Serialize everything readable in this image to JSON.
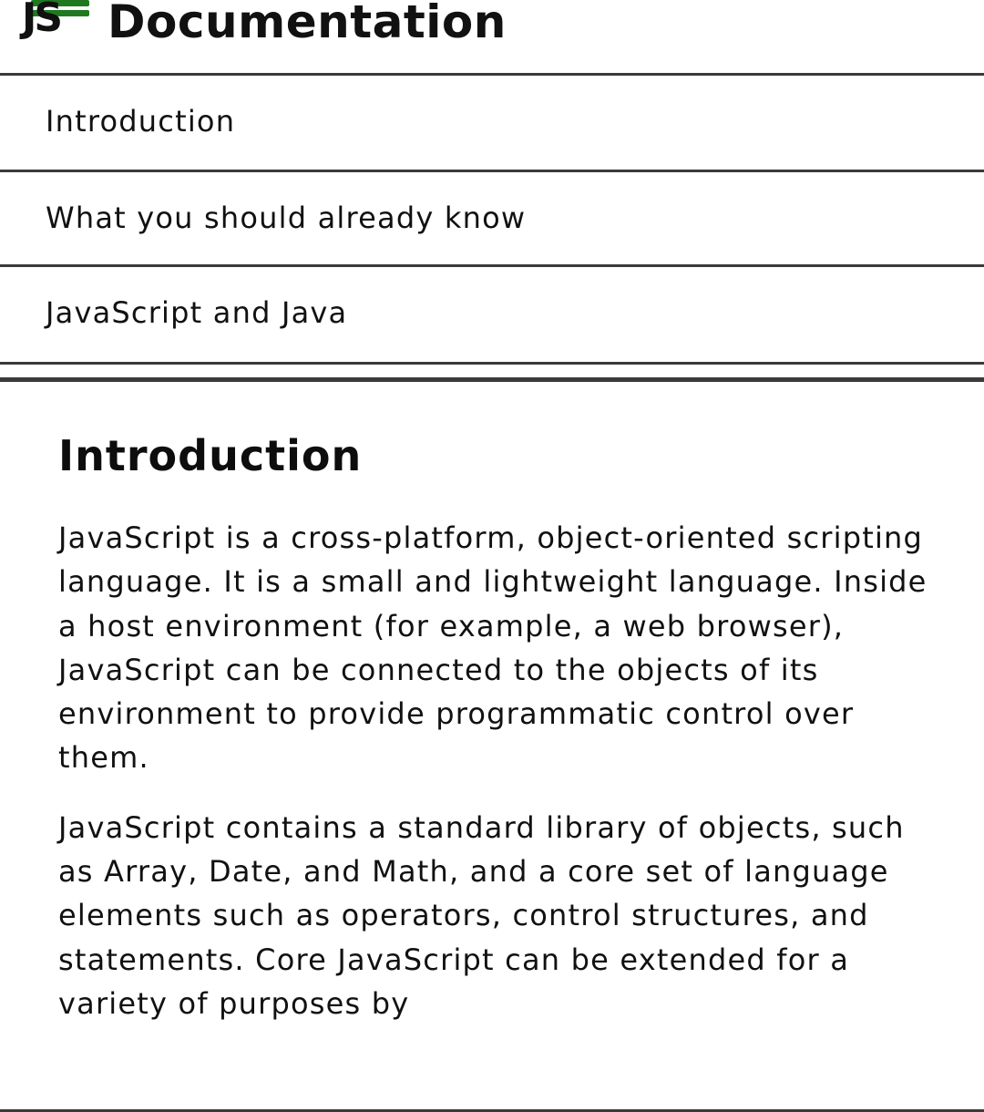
{
  "header": {
    "logo_text": "JS",
    "title": "Documentation"
  },
  "nav": {
    "items": [
      {
        "label": "Introduction"
      },
      {
        "label": "What you should already know"
      },
      {
        "label": "JavaScript and Java"
      }
    ]
  },
  "main": {
    "section_title": "Introduction",
    "paragraphs": [
      "JavaScript is a cross-platform, object-oriented scripting language. It is a small and lightweight language. Inside a host environment (for example, a web browser), JavaScript can be connected to the objects of its environment to provide programmatic control over them.",
      "JavaScript contains a standard library of objects, such as Array, Date, and Math, and a core set of language elements such as operators, control structures, and statements. Core JavaScript can be extended for a variety of purposes by"
    ]
  },
  "colors": {
    "logo_accent": "#1f7a1f",
    "rule": "#3a3a3a",
    "text": "#111111"
  },
  "icons": {
    "logo": "js-logo-icon"
  }
}
